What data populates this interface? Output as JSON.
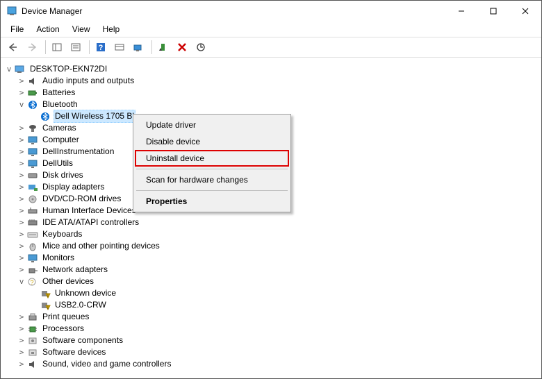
{
  "window": {
    "title": "Device Manager"
  },
  "menubar": {
    "file": "File",
    "action": "Action",
    "view": "View",
    "help": "Help"
  },
  "tree": {
    "root": "DESKTOP-EKN72DI",
    "audio": "Audio inputs and outputs",
    "batteries": "Batteries",
    "bluetooth": "Bluetooth",
    "bt_device": "Dell Wireless 1705 Bl",
    "cameras": "Cameras",
    "computer": "Computer",
    "dellinstr": "DellInstrumentation",
    "dellutils": "DellUtils",
    "disk": "Disk drives",
    "display": "Display adapters",
    "dvd": "DVD/CD-ROM drives",
    "hid": "Human Interface Devices",
    "ide": "IDE ATA/ATAPI controllers",
    "keyboards": "Keyboards",
    "mice": "Mice and other pointing devices",
    "monitors": "Monitors",
    "network": "Network adapters",
    "other": "Other devices",
    "unknown": "Unknown device",
    "usbcrw": "USB2.0-CRW",
    "printq": "Print queues",
    "processors": "Processors",
    "swcomp": "Software components",
    "swdev": "Software devices",
    "sound": "Sound, video and game controllers"
  },
  "context_menu": {
    "update": "Update driver",
    "disable": "Disable device",
    "uninstall": "Uninstall device",
    "scan": "Scan for hardware changes",
    "properties": "Properties"
  }
}
